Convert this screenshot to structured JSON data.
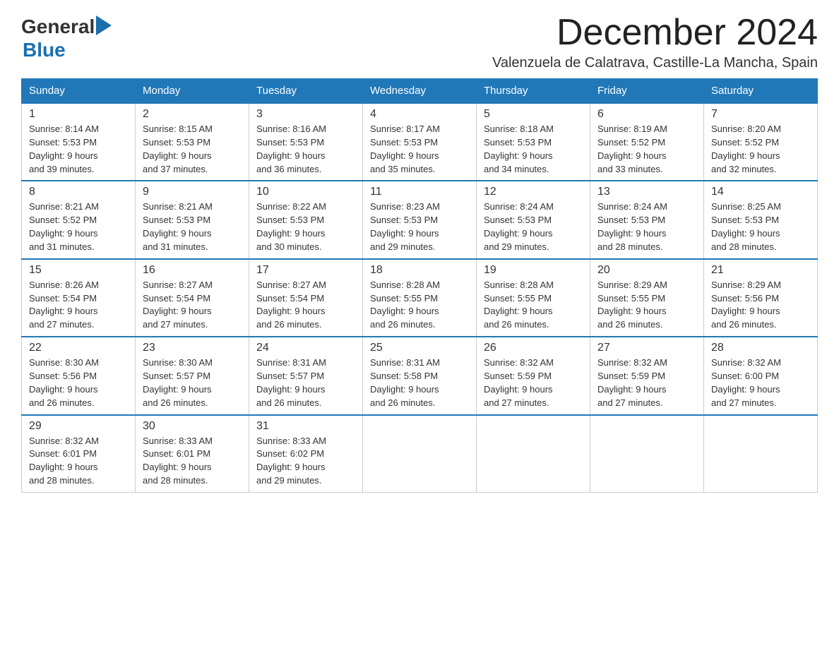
{
  "logo": {
    "text_general": "General",
    "text_blue": "Blue",
    "arrow": "▶"
  },
  "title": {
    "month": "December 2024",
    "location": "Valenzuela de Calatrava, Castille-La Mancha, Spain"
  },
  "weekdays": [
    "Sunday",
    "Monday",
    "Tuesday",
    "Wednesday",
    "Thursday",
    "Friday",
    "Saturday"
  ],
  "weeks": [
    [
      {
        "day": "1",
        "sunrise": "8:14 AM",
        "sunset": "5:53 PM",
        "daylight": "9 hours and 39 minutes."
      },
      {
        "day": "2",
        "sunrise": "8:15 AM",
        "sunset": "5:53 PM",
        "daylight": "9 hours and 37 minutes."
      },
      {
        "day": "3",
        "sunrise": "8:16 AM",
        "sunset": "5:53 PM",
        "daylight": "9 hours and 36 minutes."
      },
      {
        "day": "4",
        "sunrise": "8:17 AM",
        "sunset": "5:53 PM",
        "daylight": "9 hours and 35 minutes."
      },
      {
        "day": "5",
        "sunrise": "8:18 AM",
        "sunset": "5:53 PM",
        "daylight": "9 hours and 34 minutes."
      },
      {
        "day": "6",
        "sunrise": "8:19 AM",
        "sunset": "5:52 PM",
        "daylight": "9 hours and 33 minutes."
      },
      {
        "day": "7",
        "sunrise": "8:20 AM",
        "sunset": "5:52 PM",
        "daylight": "9 hours and 32 minutes."
      }
    ],
    [
      {
        "day": "8",
        "sunrise": "8:21 AM",
        "sunset": "5:52 PM",
        "daylight": "9 hours and 31 minutes."
      },
      {
        "day": "9",
        "sunrise": "8:21 AM",
        "sunset": "5:53 PM",
        "daylight": "9 hours and 31 minutes."
      },
      {
        "day": "10",
        "sunrise": "8:22 AM",
        "sunset": "5:53 PM",
        "daylight": "9 hours and 30 minutes."
      },
      {
        "day": "11",
        "sunrise": "8:23 AM",
        "sunset": "5:53 PM",
        "daylight": "9 hours and 29 minutes."
      },
      {
        "day": "12",
        "sunrise": "8:24 AM",
        "sunset": "5:53 PM",
        "daylight": "9 hours and 29 minutes."
      },
      {
        "day": "13",
        "sunrise": "8:24 AM",
        "sunset": "5:53 PM",
        "daylight": "9 hours and 28 minutes."
      },
      {
        "day": "14",
        "sunrise": "8:25 AM",
        "sunset": "5:53 PM",
        "daylight": "9 hours and 28 minutes."
      }
    ],
    [
      {
        "day": "15",
        "sunrise": "8:26 AM",
        "sunset": "5:54 PM",
        "daylight": "9 hours and 27 minutes."
      },
      {
        "day": "16",
        "sunrise": "8:27 AM",
        "sunset": "5:54 PM",
        "daylight": "9 hours and 27 minutes."
      },
      {
        "day": "17",
        "sunrise": "8:27 AM",
        "sunset": "5:54 PM",
        "daylight": "9 hours and 26 minutes."
      },
      {
        "day": "18",
        "sunrise": "8:28 AM",
        "sunset": "5:55 PM",
        "daylight": "9 hours and 26 minutes."
      },
      {
        "day": "19",
        "sunrise": "8:28 AM",
        "sunset": "5:55 PM",
        "daylight": "9 hours and 26 minutes."
      },
      {
        "day": "20",
        "sunrise": "8:29 AM",
        "sunset": "5:55 PM",
        "daylight": "9 hours and 26 minutes."
      },
      {
        "day": "21",
        "sunrise": "8:29 AM",
        "sunset": "5:56 PM",
        "daylight": "9 hours and 26 minutes."
      }
    ],
    [
      {
        "day": "22",
        "sunrise": "8:30 AM",
        "sunset": "5:56 PM",
        "daylight": "9 hours and 26 minutes."
      },
      {
        "day": "23",
        "sunrise": "8:30 AM",
        "sunset": "5:57 PM",
        "daylight": "9 hours and 26 minutes."
      },
      {
        "day": "24",
        "sunrise": "8:31 AM",
        "sunset": "5:57 PM",
        "daylight": "9 hours and 26 minutes."
      },
      {
        "day": "25",
        "sunrise": "8:31 AM",
        "sunset": "5:58 PM",
        "daylight": "9 hours and 26 minutes."
      },
      {
        "day": "26",
        "sunrise": "8:32 AM",
        "sunset": "5:59 PM",
        "daylight": "9 hours and 27 minutes."
      },
      {
        "day": "27",
        "sunrise": "8:32 AM",
        "sunset": "5:59 PM",
        "daylight": "9 hours and 27 minutes."
      },
      {
        "day": "28",
        "sunrise": "8:32 AM",
        "sunset": "6:00 PM",
        "daylight": "9 hours and 27 minutes."
      }
    ],
    [
      {
        "day": "29",
        "sunrise": "8:32 AM",
        "sunset": "6:01 PM",
        "daylight": "9 hours and 28 minutes."
      },
      {
        "day": "30",
        "sunrise": "8:33 AM",
        "sunset": "6:01 PM",
        "daylight": "9 hours and 28 minutes."
      },
      {
        "day": "31",
        "sunrise": "8:33 AM",
        "sunset": "6:02 PM",
        "daylight": "9 hours and 29 minutes."
      },
      null,
      null,
      null,
      null
    ]
  ],
  "labels": {
    "sunrise": "Sunrise: ",
    "sunset": "Sunset: ",
    "daylight": "Daylight: "
  }
}
